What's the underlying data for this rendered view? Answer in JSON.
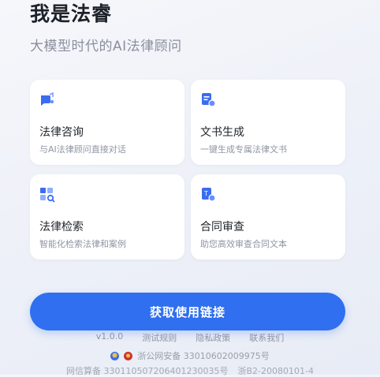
{
  "header": {
    "title": "我是法睿",
    "subtitle": "大模型时代的AI法律顾问"
  },
  "cards": [
    {
      "title": "法律咨询",
      "desc": "与AI法律顾问直接对话",
      "icon": "chat-icon"
    },
    {
      "title": "文书生成",
      "desc": "一键生成专属法律文书",
      "icon": "document-icon"
    },
    {
      "title": "法律检索",
      "desc": "智能化检索法律和案例",
      "icon": "search-icon"
    },
    {
      "title": "合同审查",
      "desc": "助您高效审查合同文本",
      "icon": "contract-icon"
    }
  ],
  "cta": {
    "label": "获取使用链接"
  },
  "footer": {
    "version": "v1.0.0",
    "links": [
      "测试规则",
      "隐私政策",
      "联系我们"
    ],
    "police_record": "浙公网安备 33010602009975号",
    "icp_record": "网信算备 330110507206401230035号",
    "icp_number": "浙B2-20080101-4"
  },
  "colors": {
    "accent": "#2f6ff0",
    "card_bg": "#ffffff",
    "icon_blue": "#3a6df0"
  }
}
